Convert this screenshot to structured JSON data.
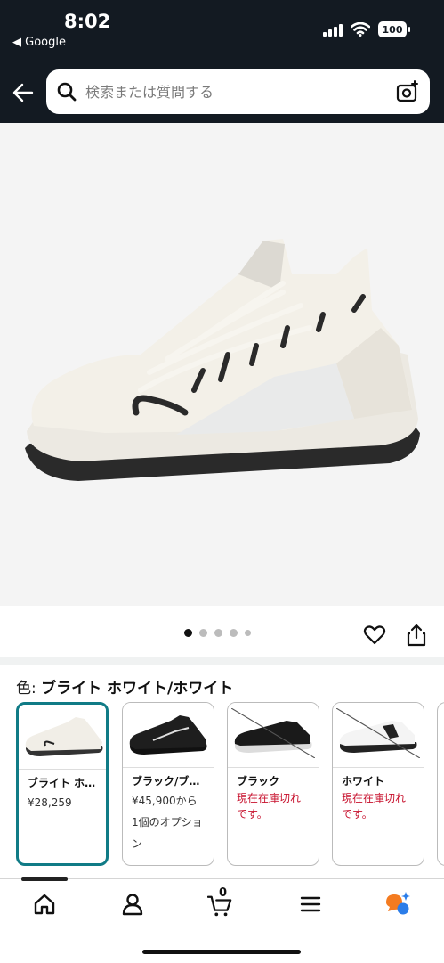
{
  "status": {
    "time": "8:02",
    "back_app": "◀ Google",
    "battery": "100"
  },
  "search": {
    "placeholder": "検索または質問する"
  },
  "product": {
    "color_label": "色:",
    "color_value": "ブライト ホワイト/ホワイト",
    "variants": [
      {
        "name": "ブライト ホ…",
        "price": "¥28,259",
        "selected": true
      },
      {
        "name": "ブラック/ブ…",
        "price_line1": "¥45,900から",
        "price_line2": "1個のオプショ",
        "price_line3": "ン"
      },
      {
        "name": "ブラック",
        "stock_line1": "現在在庫切れ",
        "stock_line2": "です。"
      },
      {
        "name": "ホワイト",
        "stock_line1": "現在在庫切れ",
        "stock_line2": "です。"
      }
    ]
  },
  "nav": {
    "cart_count": "0"
  },
  "colors": {
    "header_bg": "#131a22",
    "selected_border": "#107b86",
    "out_of_stock": "#c7102c"
  }
}
